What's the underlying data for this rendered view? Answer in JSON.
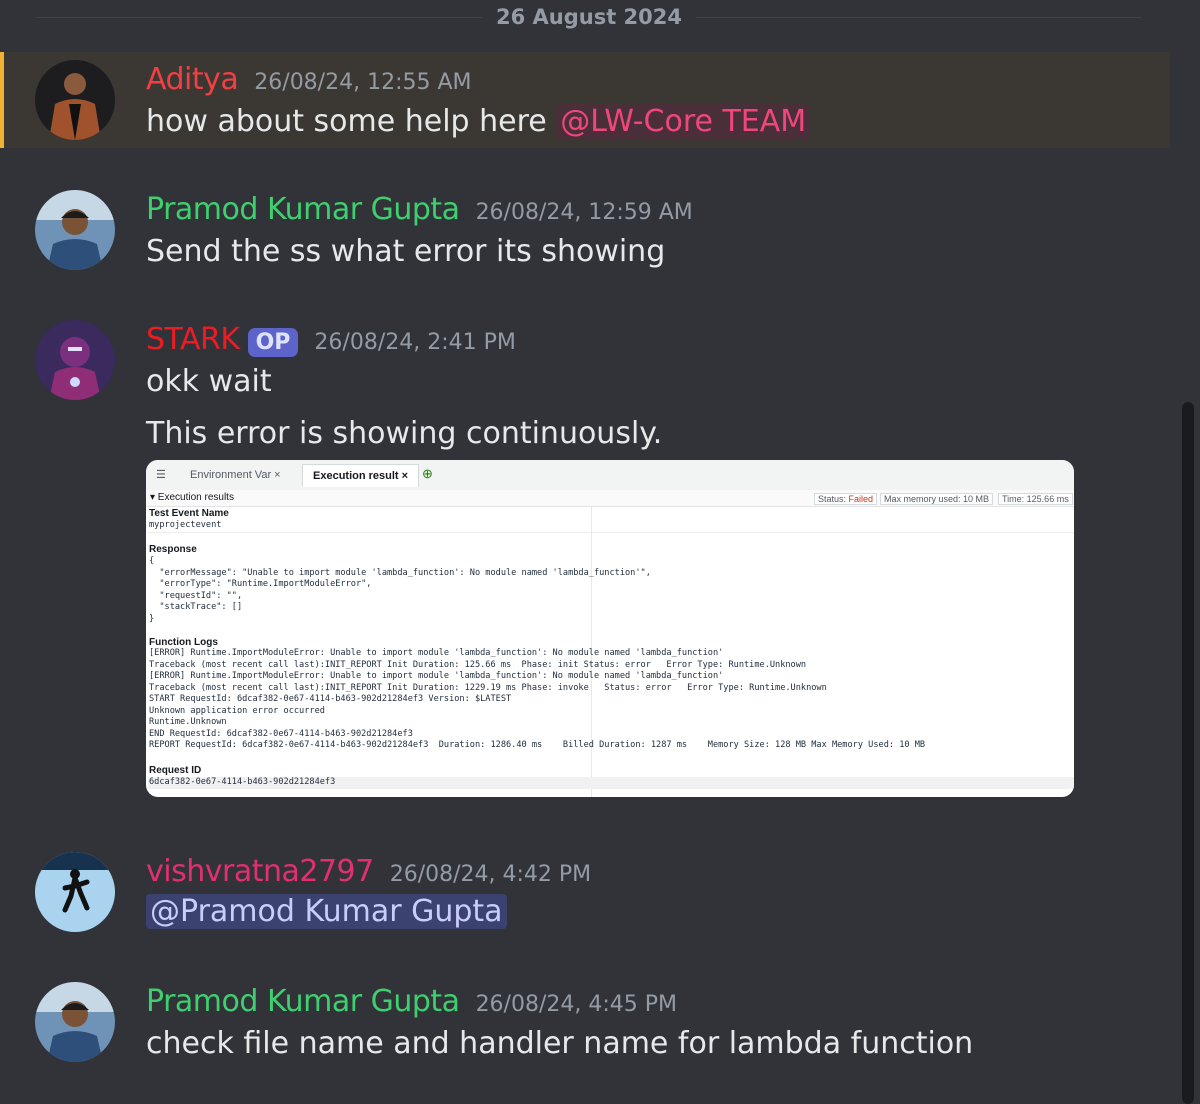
{
  "date_divider": "26 August 2024",
  "messages": [
    {
      "username": "Aditya",
      "username_color": "#f23f43",
      "timestamp": "26/08/24, 12:55 AM",
      "text": "how about some help here",
      "mention": "@LW-Core TEAM"
    },
    {
      "username": "Pramod Kumar Gupta",
      "username_color": "#3ecf6e",
      "timestamp": "26/08/24, 12:59 AM",
      "text": "Send the ss what error its showing"
    },
    {
      "username": "STARK",
      "username_color": "#ed1c24",
      "badge": "OP",
      "timestamp": "26/08/24, 2:41 PM",
      "text": "okk wait",
      "text2": "This error is showing continuously."
    },
    {
      "username": "vishvratna2797",
      "username_color": "#e0306e",
      "timestamp": "26/08/24, 4:42 PM",
      "mention": "@Pramod Kumar Gupta"
    },
    {
      "username": "Pramod Kumar Gupta",
      "username_color": "#3ecf6e",
      "timestamp": "26/08/24, 4:45 PM",
      "text": "check file name and handler name for lambda function"
    }
  ],
  "attachment": {
    "tab1": "Environment Var ×",
    "tab2": "Execution result ×",
    "section": "▾ Execution results",
    "status_label": "Status:",
    "status_value": "Failed",
    "max_memory": "Max memory used: 10 MB",
    "time": "Time: 125.66 ms",
    "test_event_label": "Test Event Name",
    "test_event_value": "myprojectevent",
    "response_label": "Response",
    "response_lines": [
      "{",
      "  \"errorMessage\": \"Unable to import module 'lambda_function': No module named 'lambda_function'\",",
      "  \"errorType\": \"Runtime.ImportModuleError\",",
      "  \"requestId\": \"\",",
      "  \"stackTrace\": []",
      "}"
    ],
    "logs_label": "Function Logs",
    "log_lines": [
      "[ERROR] Runtime.ImportModuleError: Unable to import module 'lambda_function': No module named 'lambda_function'",
      "Traceback (most recent call last):INIT_REPORT Init Duration: 125.66 ms  Phase: init Status: error   Error Type: Runtime.Unknown",
      "[ERROR] Runtime.ImportModuleError: Unable to import module 'lambda_function': No module named 'lambda_function'",
      "Traceback (most recent call last):INIT_REPORT Init Duration: 1229.19 ms Phase: invoke   Status: error   Error Type: Runtime.Unknown",
      "START RequestId: 6dcaf382-0e67-4114-b463-902d21284ef3 Version: $LATEST",
      "Unknown application error occurred",
      "Runtime.Unknown",
      "END RequestId: 6dcaf382-0e67-4114-b463-902d21284ef3",
      "REPORT RequestId: 6dcaf382-0e67-4114-b463-902d21284ef3  Duration: 1286.40 ms    Billed Duration: 1287 ms    Memory Size: 128 MB Max Memory Used: 10 MB"
    ],
    "request_id_label": "Request ID",
    "request_id_value": "6dcaf382-0e67-4114-b463-902d21284ef3"
  }
}
